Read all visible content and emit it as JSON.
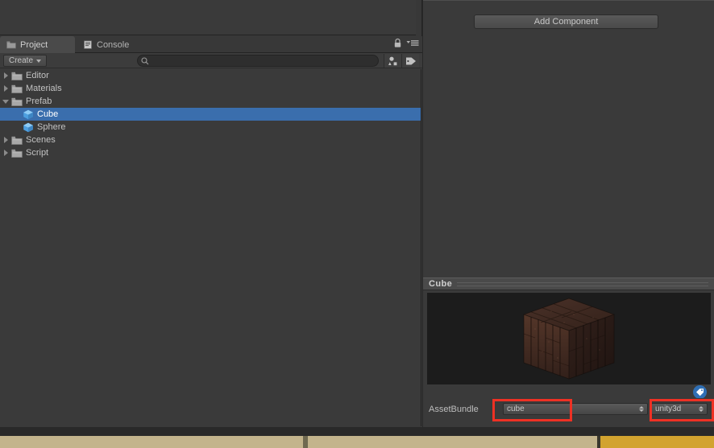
{
  "window": {
    "theme_bg": "#3a3a3a",
    "accent_selection": "#3a6ead",
    "highlight_color": "#ee3124"
  },
  "project_panel": {
    "tabs": [
      {
        "label": "Project",
        "icon": "folder-icon",
        "active": true
      },
      {
        "label": "Console",
        "icon": "console-icon",
        "active": false
      }
    ],
    "tabbar_icons": [
      {
        "name": "lock-icon"
      },
      {
        "name": "menu-icon"
      }
    ],
    "toolbar": {
      "create_label": "Create",
      "create_caret": "chevron-down-icon",
      "search_value": "",
      "search_placeholder": "",
      "search_icon": "search-icon",
      "filter_buttons": [
        {
          "name": "filter-by-type-icon"
        },
        {
          "name": "filter-by-label-icon"
        }
      ]
    },
    "tree": [
      {
        "label": "Editor",
        "icon": "folder-icon",
        "depth": 1,
        "expanded": false,
        "has_children": true,
        "selected": false
      },
      {
        "label": "Materials",
        "icon": "folder-icon",
        "depth": 1,
        "expanded": false,
        "has_children": true,
        "selected": false
      },
      {
        "label": "Prefab",
        "icon": "folder-icon",
        "depth": 1,
        "expanded": true,
        "has_children": true,
        "selected": false
      },
      {
        "label": "Cube",
        "icon": "prefab-icon",
        "depth": 2,
        "expanded": false,
        "has_children": false,
        "selected": true
      },
      {
        "label": "Sphere",
        "icon": "prefab-icon",
        "depth": 2,
        "expanded": false,
        "has_children": false,
        "selected": false
      },
      {
        "label": "Scenes",
        "icon": "folder-icon",
        "depth": 1,
        "expanded": false,
        "has_children": true,
        "selected": false
      },
      {
        "label": "Script",
        "icon": "folder-icon",
        "depth": 1,
        "expanded": false,
        "has_children": true,
        "selected": false
      }
    ]
  },
  "inspector": {
    "add_component_label": "Add Component",
    "preview": {
      "title": "Cube",
      "object_name": "cube-preview-3d"
    },
    "tag_badge_icon": "asset-label-tag-icon",
    "assetbundle": {
      "label": "AssetBundle",
      "name_value": "cube",
      "variant_value": "unity3d",
      "name_highlighted": true,
      "variant_highlighted": true
    }
  },
  "bottom_bar": {
    "segments": [
      {
        "name": "timeline-segment-left",
        "color": "#c3b48c"
      },
      {
        "name": "timeline-divider",
        "color": "#6f6950"
      },
      {
        "name": "timeline-segment-middle",
        "color": "#c3b48c"
      },
      {
        "name": "timeline-divider-2",
        "color": "#3a372c"
      },
      {
        "name": "timeline-segment-gold",
        "color": "#d2a32f"
      }
    ]
  }
}
